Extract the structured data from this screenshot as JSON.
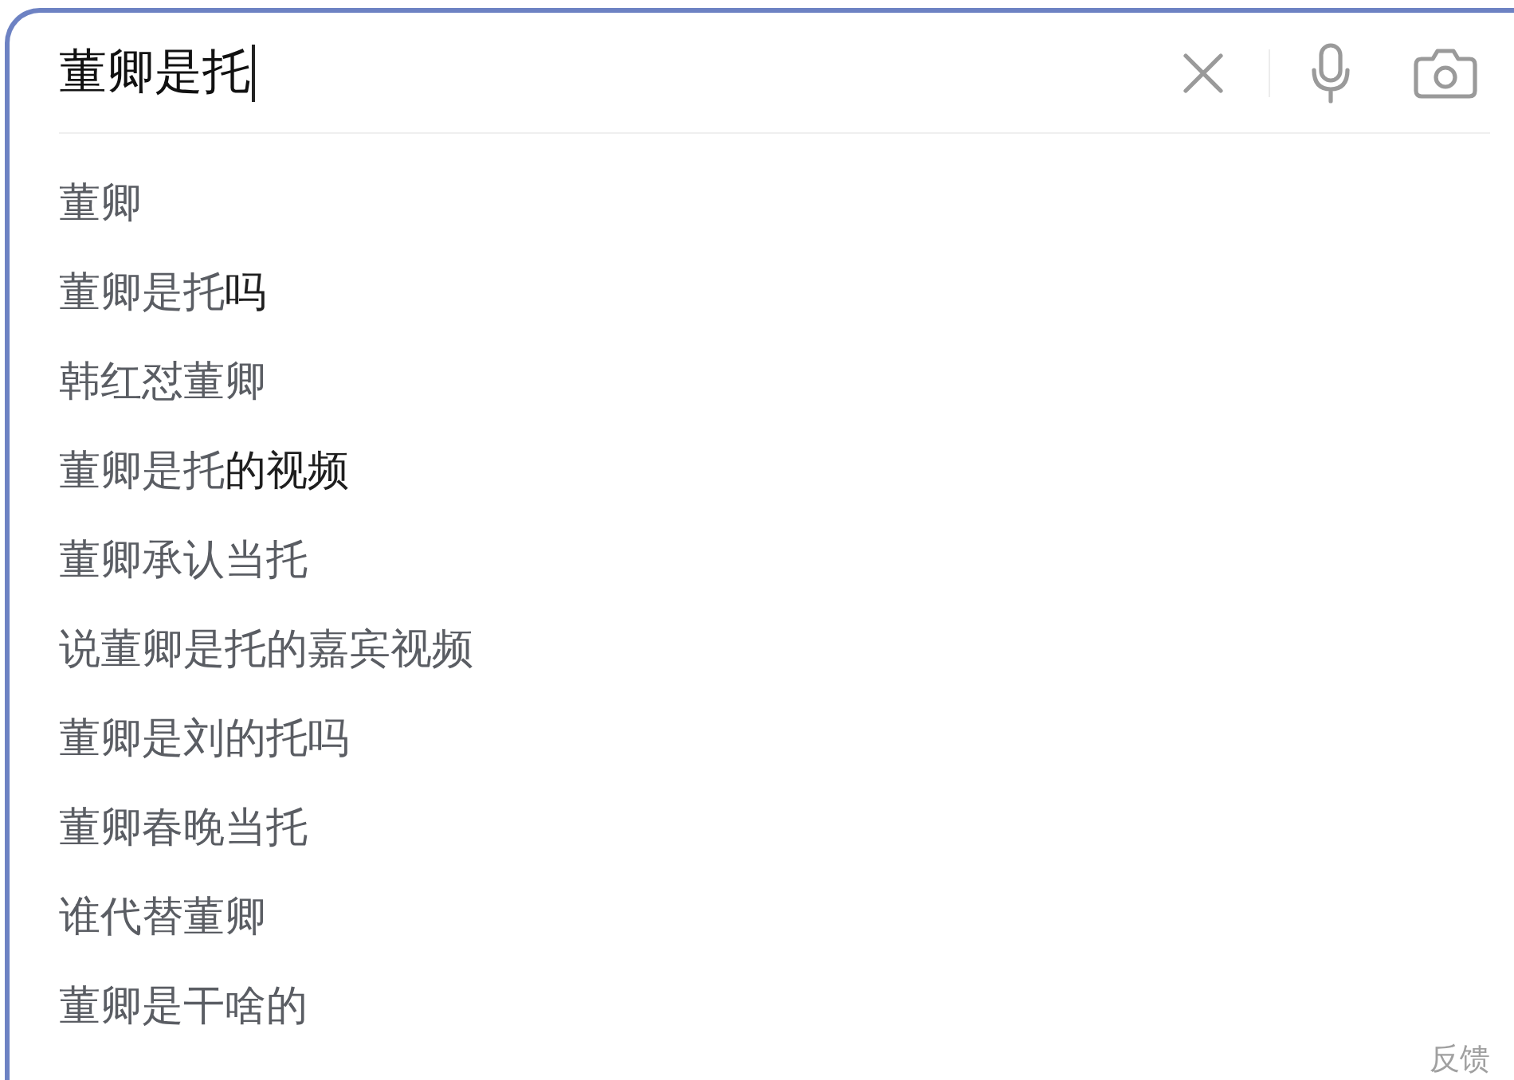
{
  "search": {
    "query": "董卿是托",
    "focused": true
  },
  "suggestions": [
    {
      "text": "董卿"
    },
    {
      "text": "董卿是托",
      "completion": "吗"
    },
    {
      "text": "韩红怼董卿"
    },
    {
      "text": "董卿是托",
      "completion": "的视频"
    },
    {
      "text": "董卿承认当托"
    },
    {
      "text": "说董卿是托的嘉宾视频"
    },
    {
      "text": "董卿是刘的托吗"
    },
    {
      "text": "董卿春晚当托"
    },
    {
      "text": "谁代替董卿"
    },
    {
      "text": "董卿是干啥的"
    }
  ],
  "feedback_link": "反馈"
}
